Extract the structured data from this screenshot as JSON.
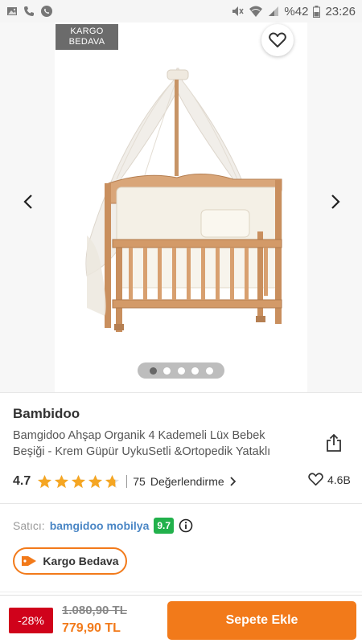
{
  "status_bar": {
    "left_icons": [
      "gallery-icon",
      "phone-icon",
      "whatsapp-icon"
    ],
    "right_icons": [
      "mute-icon",
      "wifi-icon",
      "signal-icon",
      "battery-icon"
    ],
    "battery": "%42",
    "time": "23:26"
  },
  "gallery": {
    "badge_line1": "KARGO",
    "badge_line2": "BEDAVA",
    "image_count": 5,
    "active_index": 0
  },
  "product": {
    "brand": "Bambidoo",
    "title": "Bamgidoo Ahşap Organik 4 Kademeli Lüx Bebek Beşiği - Krem Güpür UykuSetli &Ortopedik Yataklı",
    "rating": "4.7",
    "rating_value": 4.7,
    "stars_max": 5,
    "review_count": "75",
    "review_label": "Değerlendirme",
    "likes": "4.6B"
  },
  "seller": {
    "label": "Satıcı:",
    "name": "bamgidoo mobilya",
    "score": "9.7"
  },
  "chip": {
    "label": "Kargo Bedava"
  },
  "bottom": {
    "discount": "-28%",
    "old_price": "1.080,90 TL",
    "new_price": "779,90 TL",
    "cart_label": "Sepete Ekle"
  },
  "colors": {
    "accent": "#f27a1a",
    "discount": "#d0021b",
    "seller_score": "#22b14c",
    "star": "#f5a623",
    "link": "#4a86c5"
  }
}
